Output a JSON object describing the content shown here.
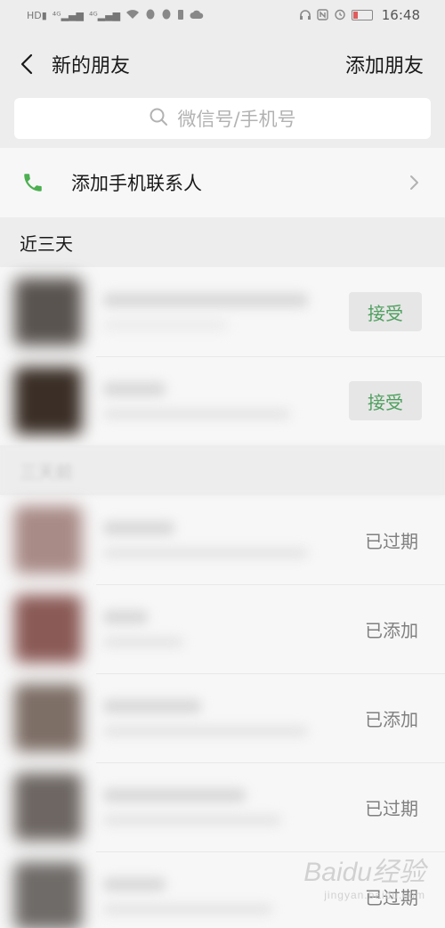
{
  "status_bar": {
    "time": "16:48",
    "left_icons": [
      "HD",
      "4G",
      "4G",
      "wifi-icon",
      "qq-icon",
      "qq-icon",
      "notif-icon",
      "cloud-icon"
    ],
    "right_icons": [
      "headset-icon",
      "nfc-icon",
      "alarm-icon",
      "battery-icon"
    ]
  },
  "nav": {
    "title": "新的朋友",
    "action": "添加朋友"
  },
  "search": {
    "placeholder": "微信号/手机号"
  },
  "phone_contacts": {
    "label": "添加手机联系人",
    "icon": "phone-icon",
    "icon_color": "#4caf50"
  },
  "sections": [
    {
      "title": "近三天"
    },
    {
      "title": "三天前"
    }
  ],
  "recent": [
    {
      "action": "接受",
      "avatar_color": "#5a5450"
    },
    {
      "action": "接受",
      "avatar_color": "#3a2e26"
    }
  ],
  "older": [
    {
      "status": "已过期",
      "avatar_color": "#a88a86"
    },
    {
      "status": "已添加",
      "avatar_color": "#8a5a56"
    },
    {
      "status": "已添加",
      "avatar_color": "#7d6e66"
    },
    {
      "status": "已过期",
      "avatar_color": "#6d6662"
    },
    {
      "status": "已过期",
      "avatar_color": "#6f6b68"
    }
  ],
  "colors": {
    "accent_green": "#4e9f5e",
    "background": "#ededed",
    "row_background": "#f7f7f7"
  },
  "watermark": {
    "text": "Baidu经验",
    "subtext": "jingyan.baidu.com"
  }
}
